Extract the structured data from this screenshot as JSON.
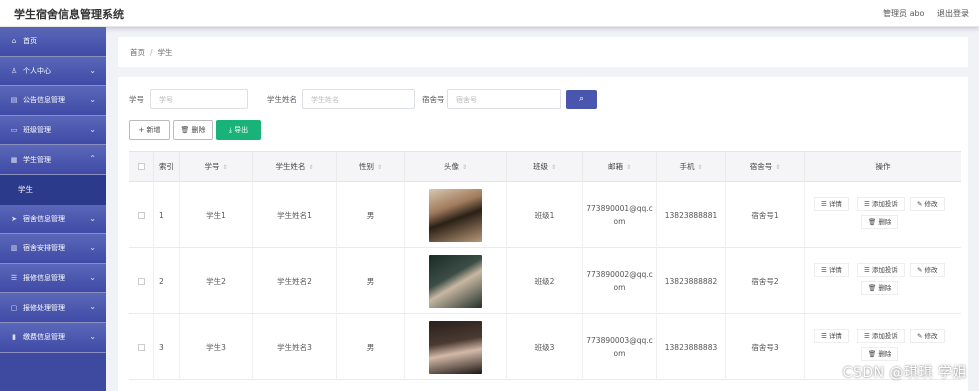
{
  "app": {
    "title": "学生宿舍信息管理系统",
    "admin": "管理员 abo",
    "logout": "退出登录"
  },
  "sidebar": {
    "items": [
      {
        "label": "首页",
        "icon": "home-icon"
      },
      {
        "label": "个人中心",
        "icon": "user-icon"
      },
      {
        "label": "公告信息管理",
        "icon": "notice-icon"
      },
      {
        "label": "班级管理",
        "icon": "class-icon"
      },
      {
        "label": "学生管理",
        "icon": "grid-icon",
        "expanded": true
      },
      {
        "label": "学生",
        "sub": true
      },
      {
        "label": "宿舍信息管理",
        "icon": "send-icon"
      },
      {
        "label": "宿舍安排管理",
        "icon": "list-icon"
      },
      {
        "label": "报修信息管理",
        "icon": "bars-icon"
      },
      {
        "label": "报修处理管理",
        "icon": "doc-icon"
      },
      {
        "label": "缴费信息管理",
        "icon": "chart-icon"
      }
    ]
  },
  "breadcrumb": {
    "home": "首页",
    "sep": "/",
    "current": "学生"
  },
  "filters": {
    "student_no": {
      "label": "学号",
      "placeholder": "学号"
    },
    "student_name": {
      "label": "学生姓名",
      "placeholder": "学生姓名"
    },
    "dorm_no": {
      "label": "宿舍号",
      "placeholder": "宿舍号"
    }
  },
  "actions": {
    "add": "+ 新增",
    "delete": "🗑 删除",
    "export": "⤓ 导出"
  },
  "table": {
    "headers": [
      "索引",
      "学号",
      "学生姓名",
      "性别",
      "头像",
      "班级",
      "邮箱",
      "手机",
      "宿舍号",
      "操作"
    ],
    "rows": [
      {
        "index": "1",
        "no": "学生1",
        "name": "学生姓名1",
        "gender": "男",
        "cls": "班级1",
        "email1": "773890001@qq.c",
        "email2": "om",
        "phone": "13823888881",
        "dorm": "宿舍号1"
      },
      {
        "index": "2",
        "no": "学生2",
        "name": "学生姓名2",
        "gender": "男",
        "cls": "班级2",
        "email1": "773890002@qq.c",
        "email2": "om",
        "phone": "13823888882",
        "dorm": "宿舍号2"
      },
      {
        "index": "3",
        "no": "学生3",
        "name": "学生姓名3",
        "gender": "男",
        "cls": "班级3",
        "email1": "773890003@qq.c",
        "email2": "om",
        "phone": "13823888883",
        "dorm": "宿舍号3"
      }
    ],
    "ops": {
      "detail": "☰ 详情",
      "add_complaint": "☰ 添加投诉",
      "edit": "✎ 修改",
      "delete": "🗑 删除"
    }
  },
  "watermark": "CSDN @琪琪 学姐",
  "colors": {
    "sidebar": "#3d4aa0",
    "accent": "#4a56ad",
    "export": "#19b37a"
  }
}
